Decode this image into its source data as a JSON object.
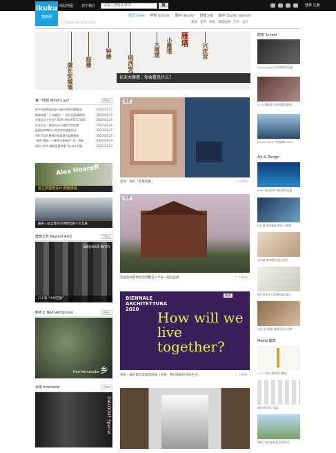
{
  "topbar": {
    "links": [
      "网站地图",
      "关于我们"
    ],
    "search_placeholder": "请输入搜索关键词",
    "search_button": "搜",
    "account": "登录  注册"
  },
  "logo": {
    "text": "ikuku",
    "sub": "建筑网"
  },
  "tagline": "CITIZENS ARCHITECTURE",
  "nav": [
    {
      "label": "首页 View",
      "active": true
    },
    {
      "label": "学校 School",
      "active": false
    },
    {
      "label": "图书 library",
      "active": false
    },
    {
      "label": "招聘 Job",
      "active": false
    },
    {
      "label": "题字 Studio abroad",
      "active": false
    }
  ],
  "subnav": [
    "建筑",
    "室内",
    "规划",
    "景观园林",
    "艺术",
    "设计"
  ],
  "hero": {
    "words": [
      "康长安城墙",
      "鼓楼",
      "钟楼",
      "明西安城墙",
      "大雁塔",
      "小雁塔",
      "雁塔",
      "兴庆宫"
    ],
    "caption": "长安大雁塔，你会看见什么？"
  },
  "news": {
    "title": "每一时刻 What's up?",
    "more": "More",
    "items": [
      {
        "title": "新乡市规划局局长与城市规划问题座谈",
        "date": "2020-03-27"
      },
      {
        "title": "建筑实践：广州展览——他们在疫情期间",
        "date": "2020-03-27"
      },
      {
        "title": "大象设计工作室 FROM ARCHITECTURE",
        "date": "2020-03-26"
      },
      {
        "title": "生活方式：城市设计与建筑学的思考",
        "date": "2020-03-26"
      },
      {
        "title": "疫情后的城市公共空间的改变设计",
        "date": "2020-03-25"
      },
      {
        "title": "WB 2020 建筑双年展报名延期通知",
        "date": "2020-03-25"
      },
      {
        "title": "\"城市·建筑——重塑未来城市\" 线上讲座",
        "date": "2020-03-24"
      },
      {
        "title": "网站 2020 建筑竞赛结果 Toyota 专题",
        "date": "2020-03-24"
      }
    ]
  },
  "promo1": {
    "title": "Alex Hoareff",
    "sub": "自之梦建筑设计 网络课程"
  },
  "promo2": {
    "caption": "曲阳 | 国立建筑的博物馆群十文案展"
  },
  "beyond": {
    "title": "建筑之外 Beyond Arch",
    "more": "More",
    "overlay": "Beyond Arch",
    "caption": "二十年 \"大时空展\""
  },
  "neo": {
    "title": "新乡土 Neo Vernacular",
    "more": "More",
    "overlay": "Neo-Vernacular",
    "mark": "乡"
  },
  "dialogue": {
    "title": "对话 Interview",
    "more": "More",
    "overlay": "DIALOGUE Special"
  },
  "features": [
    {
      "label": "住宅",
      "caption": "住宅：别的「新建筑群」",
      "more": "+ 小阅读"
    },
    {
      "label": "住宅",
      "caption": "英国的别墅改造得温馨宜人不多一般的品牌",
      "more": "+ 小阅读"
    },
    {
      "label": "展览",
      "caption": "快讯 | 威尼斯双年展建筑展（主题：我们将如何共同生活）",
      "more": "+ 小阅读"
    }
  ],
  "biennale": {
    "line1": "BIENNALE",
    "line2": "ARCHITETTURA",
    "line3": "2020",
    "headline": "How will we live together?"
  },
  "right": {
    "school_title": "院校 School",
    "school_caps": [
      "China Grand 优秀建筑作品展",
      "2019 建筑展 你好想要的建筑…",
      "Nordic Prime 中国建筑 2020"
    ],
    "art_title": "Art & Design",
    "art_caps": [
      "Alber 安全实验 纯彩色作品展",
      "设计展 城市更新 色彩 与建筑…",
      "艺术展 城市模型 展示空间",
      "现代自然水与泡沫的展览展示",
      "北京当代建筑 建筑室设计说明"
    ],
    "media_title": "Media 建筑",
    "media_caps": [
      "二十一世纪 建筑设计概况",
      "城市规划设计 展示",
      "建筑工程的新材料 获奖作品"
    ]
  }
}
